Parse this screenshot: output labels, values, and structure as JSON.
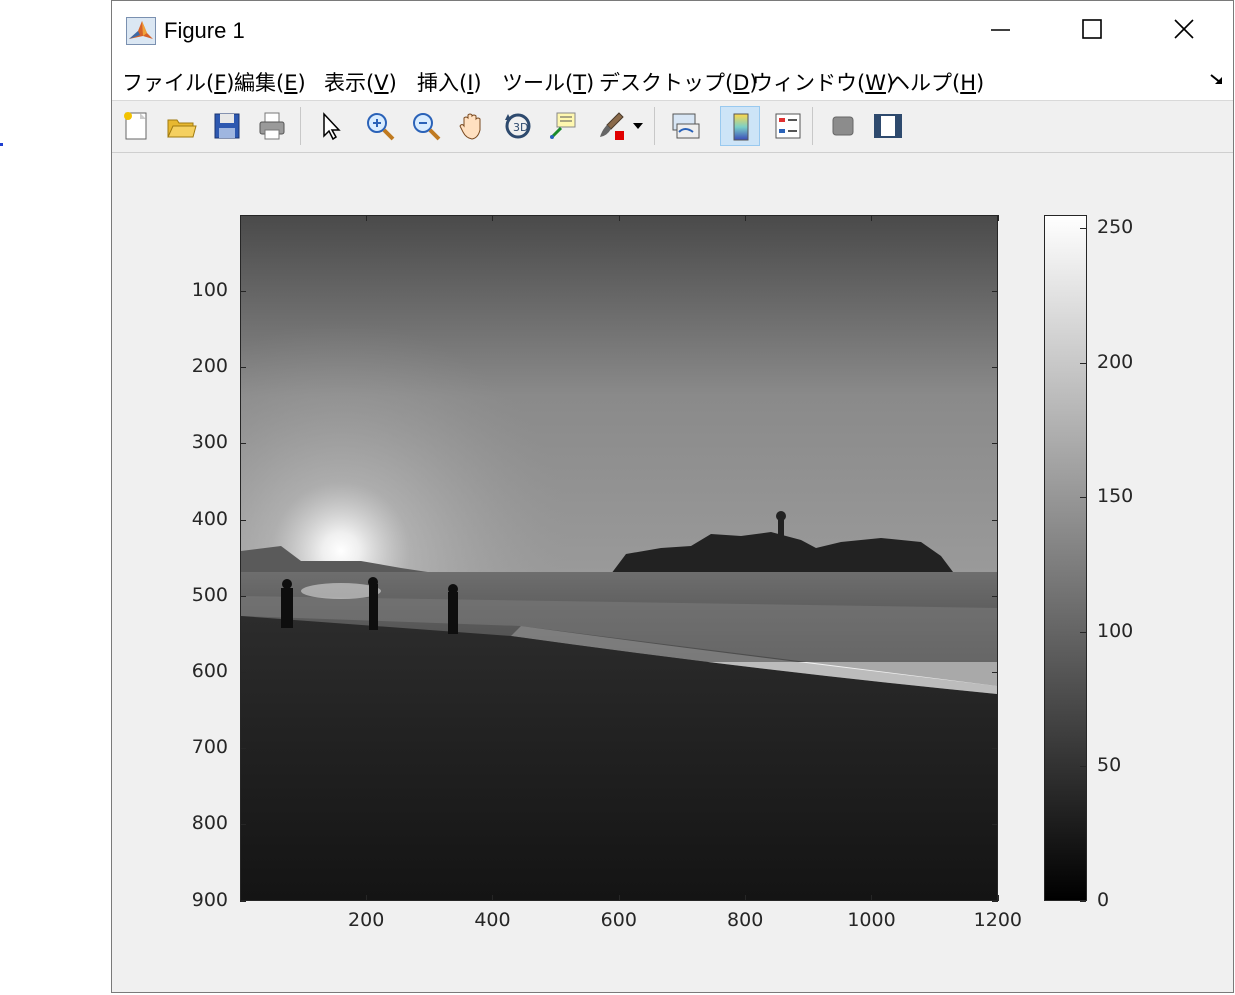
{
  "window": {
    "title": "Figure 1",
    "icon": "matlab-icon",
    "controls": [
      "minimize-icon",
      "maximize-icon",
      "close-icon"
    ]
  },
  "menu": [
    {
      "text": "ファイル(",
      "acc": "F",
      "close": ")"
    },
    {
      "text": "編集(",
      "acc": "E",
      "close": ")"
    },
    {
      "text": "表示(",
      "acc": "V",
      "close": ")"
    },
    {
      "text": "挿入(",
      "acc": "I",
      "close": ")"
    },
    {
      "text": "ツール(",
      "acc": "T",
      "close": ")"
    },
    {
      "text": "デスクトップ(",
      "acc": "D",
      "close": ")"
    },
    {
      "text": "ウィンドウ(",
      "acc": "W",
      "close": ")"
    },
    {
      "text": "ヘルプ(",
      "acc": "H",
      "close": ")"
    }
  ],
  "toolbar": [
    "new-figure-icon",
    "open-file-icon",
    "save-icon",
    "print-icon",
    "edit-plot-arrow-icon",
    "zoom-in-icon",
    "zoom-out-icon",
    "pan-hand-icon",
    "rotate-3d-icon",
    "data-cursor-icon",
    "brush-icon",
    "link-plot-icon",
    "colorbar-icon",
    "legend-icon",
    "hide-plot-tools-icon",
    "show-plot-tools-icon"
  ],
  "toolbar_active": "colorbar-icon",
  "axes": {
    "y_ticks": [
      "100",
      "200",
      "300",
      "400",
      "500",
      "600",
      "700",
      "800",
      "900"
    ],
    "x_ticks": [
      "200",
      "400",
      "600",
      "800",
      "1000",
      "1200"
    ],
    "xlim": [
      0.5,
      1200.5
    ],
    "ylim": [
      0.5,
      900.5
    ]
  },
  "image": {
    "description_colormap": "gray",
    "content": "grayscale-beach-sunset-photo"
  },
  "colorbar": {
    "ticks": [
      "250",
      "200",
      "150",
      "100",
      "50",
      "0"
    ],
    "range": [
      0,
      255
    ],
    "colormap": "gray"
  }
}
